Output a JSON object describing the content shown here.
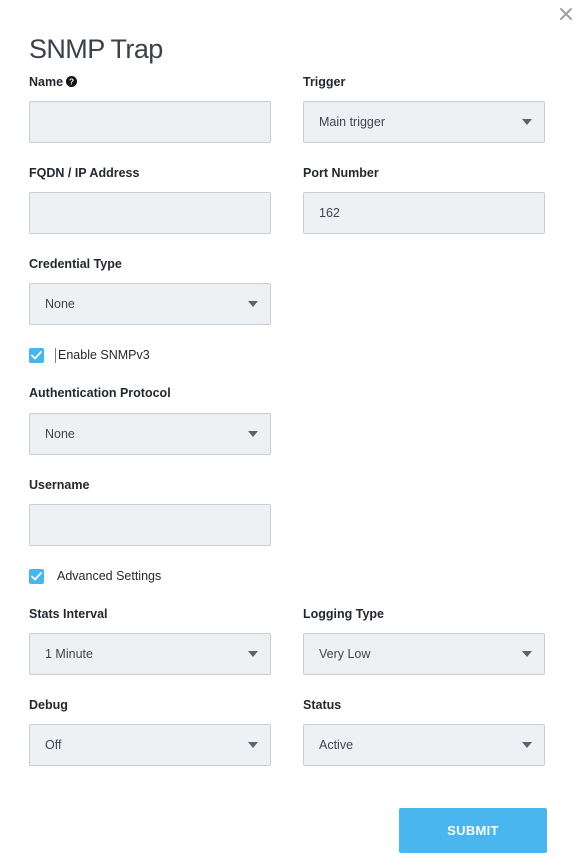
{
  "dialog": {
    "title": "SNMP Trap",
    "close_icon": "close-icon"
  },
  "fields": {
    "name": {
      "label": "Name",
      "value": "",
      "placeholder": "",
      "help_icon": "question-circle-icon"
    },
    "trigger": {
      "label": "Trigger",
      "value": "Main trigger"
    },
    "fqdn": {
      "label": "FQDN / IP Address",
      "value": "",
      "placeholder": ""
    },
    "port": {
      "label": "Port Number",
      "value": "162"
    },
    "credential_type": {
      "label": "Credential Type",
      "value": "None"
    },
    "enable_snmpv3": {
      "label": "Enable SNMPv3",
      "checked": true
    },
    "auth_protocol": {
      "label": "Authentication Protocol",
      "value": "None"
    },
    "username": {
      "label": "Username",
      "value": "",
      "placeholder": ""
    },
    "advanced_settings": {
      "label": "Advanced Settings",
      "checked": true
    },
    "stats_interval": {
      "label": "Stats Interval",
      "value": "1 Minute"
    },
    "logging_type": {
      "label": "Logging Type",
      "value": "Very Low"
    },
    "debug": {
      "label": "Debug",
      "value": "Off"
    },
    "status": {
      "label": "Status",
      "value": "Active"
    }
  },
  "actions": {
    "submit_label": "SUBMIT"
  },
  "colors": {
    "accent": "#4ab6f0",
    "checkbox": "#47b6ed",
    "field_bg": "#eef1f4",
    "field_border": "#c8ced4"
  }
}
